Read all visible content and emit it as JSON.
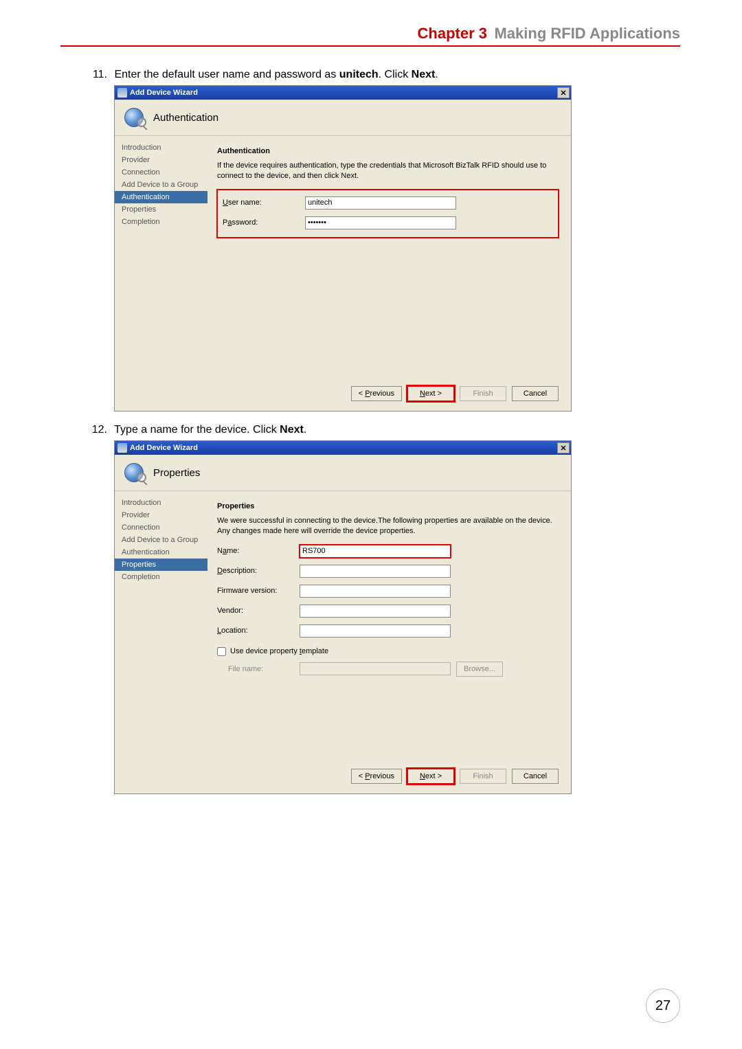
{
  "page": {
    "chapter_label": "Chapter 3",
    "chapter_title": "Making RFID Applications",
    "page_number": "27"
  },
  "steps": {
    "s11": {
      "num": "11.",
      "text_a": "Enter the default user name and password as ",
      "bold_a": "unitech",
      "text_b": ". Click ",
      "bold_b": "Next",
      "text_c": "."
    },
    "s12": {
      "num": "12.",
      "text_a": "Type a name for the device. Click ",
      "bold_a": "Next",
      "text_b": "."
    }
  },
  "wizard_common": {
    "window_title": "Add Device Wizard",
    "close_x": "×",
    "nav": [
      "Introduction",
      "Provider",
      "Connection",
      "Add Device to a Group",
      "Authentication",
      "Properties",
      "Completion"
    ],
    "buttons": {
      "previous": "< Previous",
      "next": "Next >",
      "finish": "Finish",
      "cancel": "Cancel"
    },
    "acc_previous": "P",
    "acc_next": "N",
    "acc_finish": "F"
  },
  "auth_screen": {
    "banner": "Authentication",
    "active_nav_index": 4,
    "section_title": "Authentication",
    "section_desc": "If the device requires authentication, type the credentials that Microsoft BizTalk RFID should use to connect to the device, and then click Next.",
    "user_label": "User name:",
    "user_value": "unitech",
    "pass_label": "Password:",
    "pass_value": "*******"
  },
  "props_screen": {
    "banner": "Properties",
    "active_nav_index": 5,
    "section_title": "Properties",
    "section_desc": "We were successful in connecting to the device.The following properties are available on the device. Any changes made here will override the device properties.",
    "name_label": "Name:",
    "name_value": "RS700",
    "desc_label": "Description:",
    "fw_label": "Firmware version:",
    "vendor_label": "Vendor:",
    "loc_label": "Location:",
    "chk_label": "Use device property template",
    "file_label": "File name:",
    "browse_label": "Browse...",
    "desc_value": "",
    "fw_value": "",
    "vendor_value": "",
    "loc_value": "",
    "file_value": ""
  }
}
